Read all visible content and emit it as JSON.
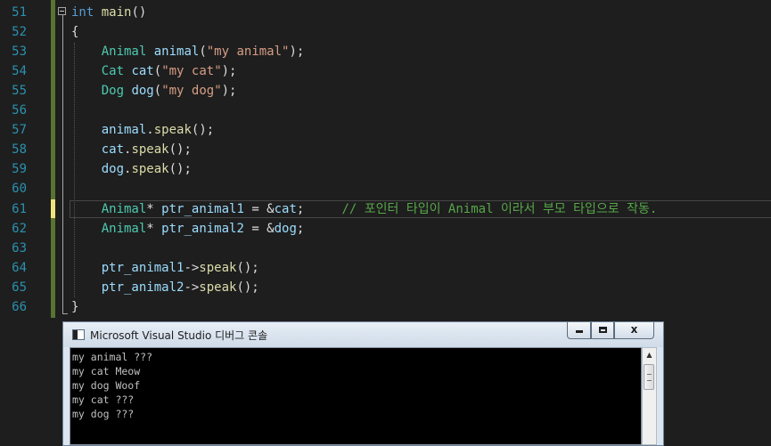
{
  "editor": {
    "line_numbers": [
      "51",
      "52",
      "53",
      "54",
      "55",
      "56",
      "57",
      "58",
      "59",
      "60",
      "61",
      "62",
      "63",
      "64",
      "65",
      "66"
    ],
    "lines": {
      "l51": {
        "kw": "int",
        "fn": "main",
        "rest": "()"
      },
      "l52": {
        "brace": "{"
      },
      "l53": {
        "type": "Animal",
        "var": "animal",
        "p1": "(",
        "str": "\"my animal\"",
        "p2": ");"
      },
      "l54": {
        "type": "Cat",
        "var": "cat",
        "p1": "(",
        "str": "\"my cat\"",
        "p2": ");"
      },
      "l55": {
        "type": "Dog",
        "var": "dog",
        "p1": "(",
        "str": "\"my dog\"",
        "p2": ");"
      },
      "l57": {
        "obj": "animal",
        "dot": ".",
        "fn": "speak",
        "rest": "();"
      },
      "l58": {
        "obj": "cat",
        "dot": ".",
        "fn": "speak",
        "rest": "();"
      },
      "l59": {
        "obj": "dog",
        "dot": ".",
        "fn": "speak",
        "rest": "();"
      },
      "l61": {
        "type": "Animal",
        "star": "*",
        "var": "ptr_animal1",
        "eq": " = &",
        "ref": "cat",
        "semi": ";",
        "comment": "// 포인터 타입이 Animal 이라서 부모 타입으로 작동."
      },
      "l62": {
        "type": "Animal",
        "star": "*",
        "var": "ptr_animal2",
        "eq": " = &",
        "ref": "dog",
        "semi": ";"
      },
      "l64": {
        "var": "ptr_animal1",
        "arrow": "->",
        "fn": "speak",
        "rest": "();"
      },
      "l65": {
        "var": "ptr_animal2",
        "arrow": "->",
        "fn": "speak",
        "rest": "();"
      },
      "l66": {
        "brace": "}"
      }
    }
  },
  "console": {
    "title": "Microsoft Visual Studio 디버그 콘솔",
    "output": [
      "my animal ???",
      "my cat Meow",
      "my dog Woof",
      "my cat ???",
      "my dog ???"
    ],
    "buttons": {
      "close": "x"
    },
    "scroll_up": "▲"
  },
  "colors": {
    "keyword": "#569cd6",
    "type": "#4ec9b0",
    "function": "#dcdcaa",
    "variable": "#9cdcfe",
    "string": "#d69d85",
    "comment": "#57a64a",
    "line_number": "#2b91af",
    "background": "#1e1e1e"
  }
}
